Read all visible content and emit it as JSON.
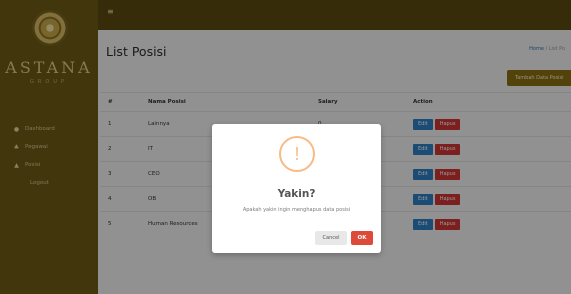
{
  "brand": {
    "name": "ASTANA",
    "sub": "GROUP"
  },
  "sidebar": {
    "items": [
      {
        "icon": "dashboard-icon",
        "glyph": "●",
        "label": "Dashboard"
      },
      {
        "icon": "users-icon",
        "glyph": "♣",
        "label": "Pegawai"
      },
      {
        "icon": "chart-icon",
        "glyph": "▲",
        "label": "Posisi"
      },
      {
        "icon": "",
        "glyph": "",
        "label": "Logout"
      }
    ]
  },
  "header": {
    "menu_glyph": "≡"
  },
  "page": {
    "title": "List Posisi",
    "breadcrumb_home": "Home",
    "breadcrumb_current": "/ List Po",
    "add_button": "Tambah Data Posisi"
  },
  "table": {
    "headers": [
      "#",
      "Nama Posisi",
      "Salary",
      "Action"
    ],
    "rows": [
      {
        "no": "1",
        "name": "Lainnya",
        "salary": "0"
      },
      {
        "no": "2",
        "name": "IT",
        "salary": ""
      },
      {
        "no": "3",
        "name": "CEO",
        "salary": ""
      },
      {
        "no": "4",
        "name": "OB",
        "salary": ""
      },
      {
        "no": "5",
        "name": "Human Resources",
        "salary": ""
      }
    ],
    "edit_label": "Edit",
    "delete_label": "Hapus"
  },
  "modal": {
    "icon_glyph": "!",
    "title": "Yakin?",
    "text": "Apakah yakin ingin menghapus data posisi",
    "cancel_label": "Cancel",
    "ok_label": "OK"
  },
  "colors": {
    "sidebar": "#6e5a14",
    "topbar": "#5a4a10",
    "edit_button": "#2e7fc4",
    "delete_button": "#cf3434",
    "ok_button": "#dd4a3a",
    "warning": "#f8bb86"
  }
}
